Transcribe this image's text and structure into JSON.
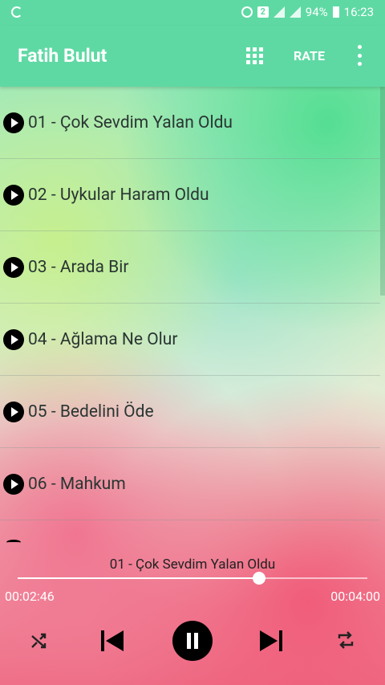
{
  "status_bar": {
    "battery": "94%",
    "time": "16:23",
    "sim": "2"
  },
  "app_bar": {
    "title": "Fatih Bulut",
    "rate_label": "RATE"
  },
  "tracks": [
    {
      "label": "01 - Çok Sevdim Yalan Oldu"
    },
    {
      "label": "02 - Uykular Haram Oldu"
    },
    {
      "label": "03 - Arada Bir"
    },
    {
      "label": "04 - Ağlama Ne Olur"
    },
    {
      "label": "05 - Bedelini Öde"
    },
    {
      "label": "06 - Mahkum"
    }
  ],
  "player": {
    "now_playing": "01 - Çok Sevdim Yalan Oldu",
    "current_time": "00:02:46",
    "total_time": "00:04:00",
    "progress": 0.69
  },
  "colors": {
    "accent": "#5fd9a4",
    "icon": "#000000"
  },
  "icons": {
    "grid": "grid-icon",
    "more": "more-vert-icon",
    "play": "play-icon",
    "shuffle": "shuffle-icon",
    "previous": "skip-previous-icon",
    "pause": "pause-icon",
    "next": "skip-next-icon",
    "repeat": "repeat-icon"
  }
}
